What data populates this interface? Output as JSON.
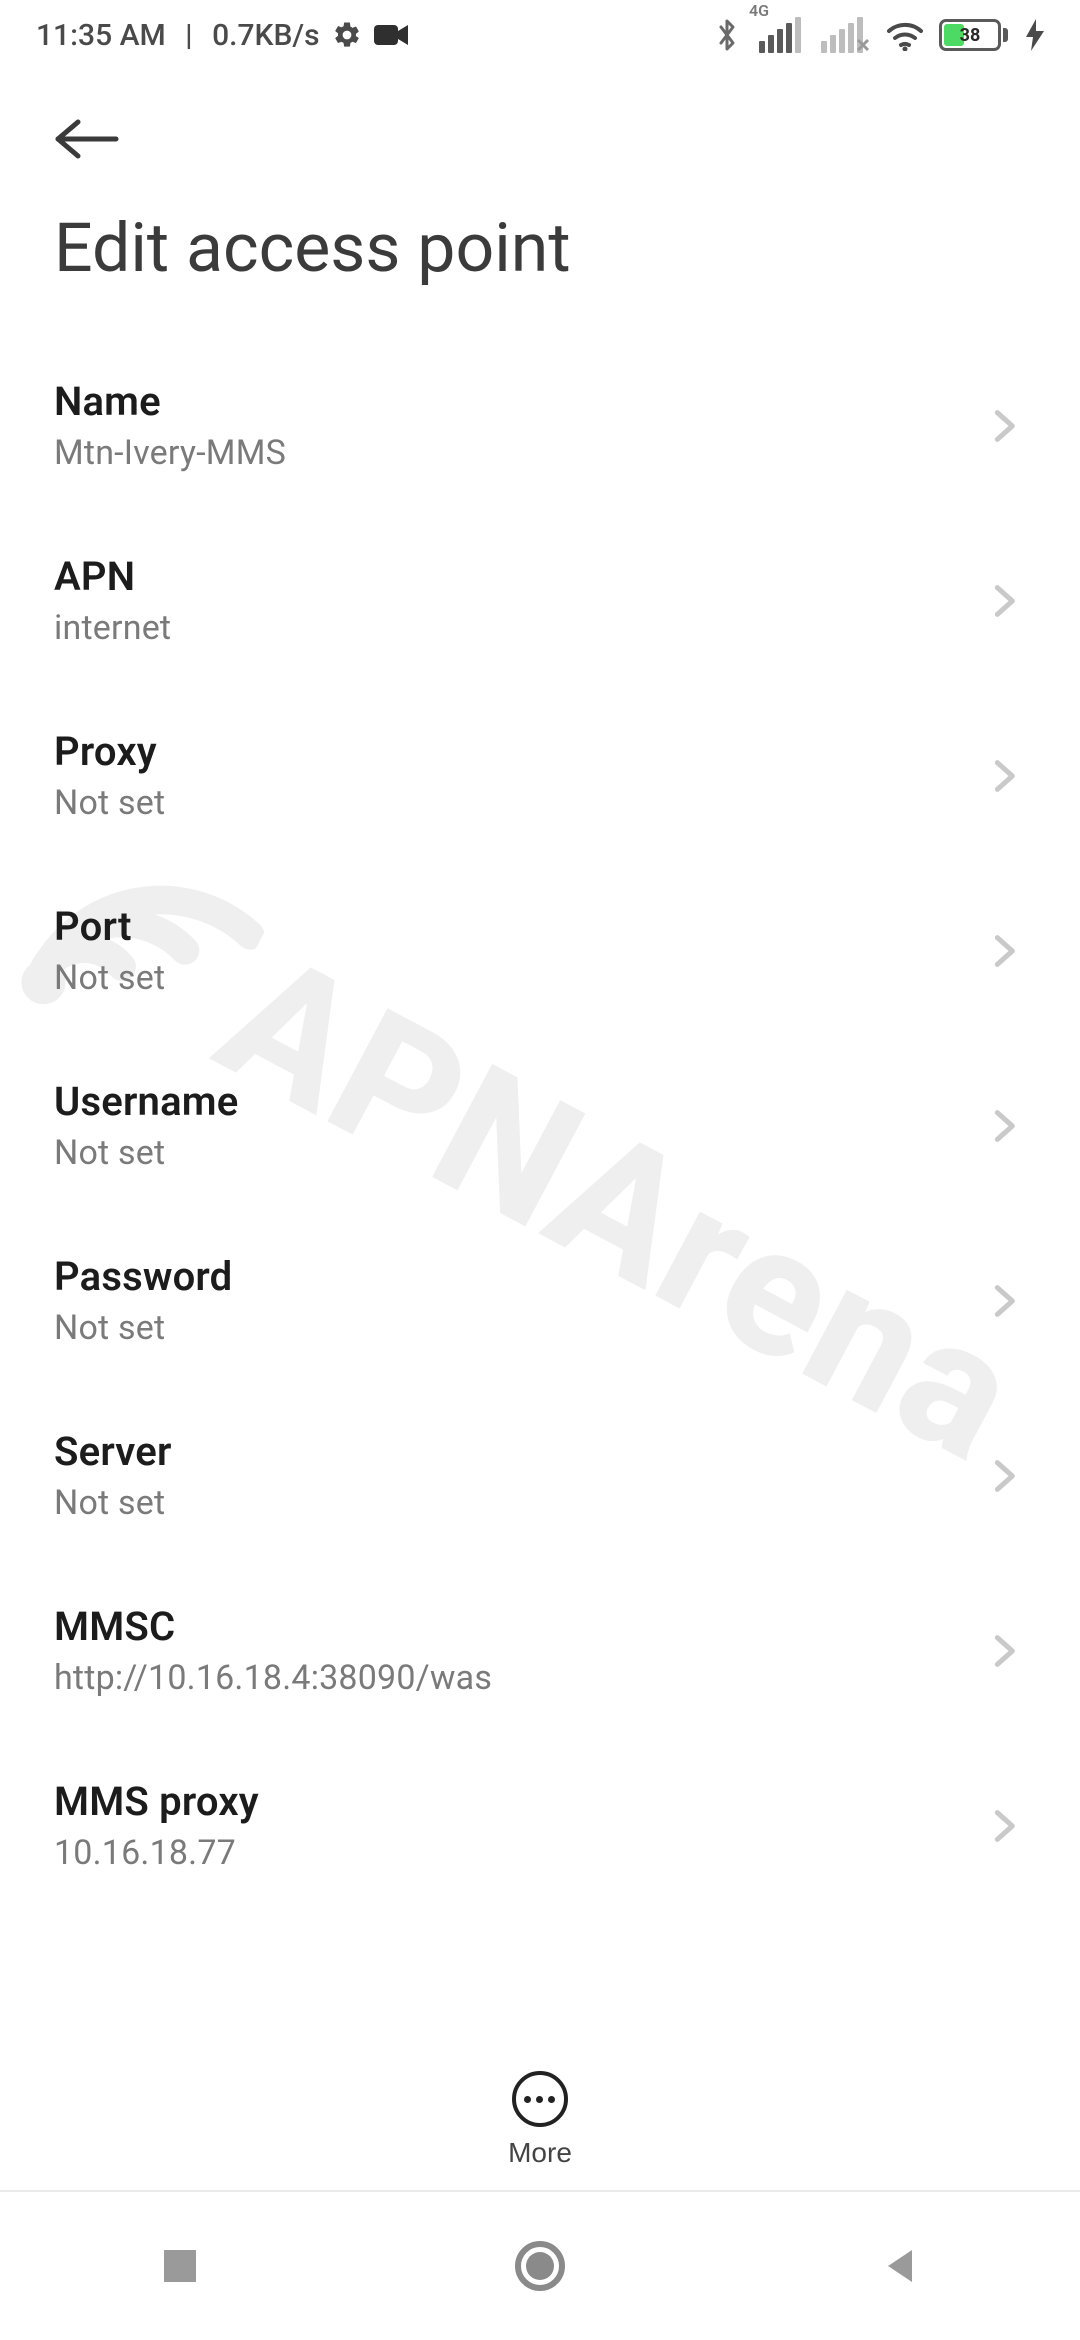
{
  "status": {
    "time": "11:35 AM",
    "rate": "0.7KB/s",
    "network_label": "4G",
    "battery_pct": "38"
  },
  "page_title": "Edit access point",
  "bottom": {
    "more_label": "More"
  },
  "watermark_text": "APNArena",
  "rows": [
    {
      "key": "name",
      "label": "Name",
      "value": "Mtn-Ivery-MMS"
    },
    {
      "key": "apn",
      "label": "APN",
      "value": "internet"
    },
    {
      "key": "proxy",
      "label": "Proxy",
      "value": "Not set"
    },
    {
      "key": "port",
      "label": "Port",
      "value": "Not set"
    },
    {
      "key": "username",
      "label": "Username",
      "value": "Not set"
    },
    {
      "key": "password",
      "label": "Password",
      "value": "Not set"
    },
    {
      "key": "server",
      "label": "Server",
      "value": "Not set"
    },
    {
      "key": "mmsc",
      "label": "MMSC",
      "value": "http://10.16.18.4:38090/was"
    },
    {
      "key": "mms-proxy",
      "label": "MMS proxy",
      "value": "10.16.18.77"
    }
  ]
}
